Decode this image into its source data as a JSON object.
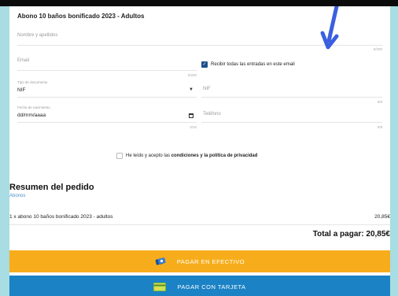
{
  "product": {
    "title": "Abono 10 baños bonificado 2023 - Adultos"
  },
  "form": {
    "name": {
      "placeholder": "Nombre y apellidos",
      "counter": "0/200"
    },
    "email": {
      "placeholder": "Email",
      "counter": "0/200"
    },
    "receive_checkbox": {
      "label": "Recibir todas las entradas en este email",
      "checked": true
    },
    "doc_type": {
      "label": "Tipo de documento",
      "value": "NIF"
    },
    "nif": {
      "placeholder": "NIF",
      "counter": "0/9"
    },
    "birth": {
      "label": "Fecha de nacimiento",
      "value": "dd/mm/aaaa",
      "counter": "0/10"
    },
    "phone": {
      "placeholder": "Teléfono",
      "counter": "0/9"
    },
    "terms": {
      "prefix": "He leído y acepto las ",
      "link": "condiciones y la política de privacidad",
      "checked": false
    }
  },
  "summary": {
    "title": "Resumen del pedido",
    "subtitle": "Abonos",
    "line_item": "1 x abono 10 baños bonificado 2023 - adultos",
    "line_price": "20,85€",
    "total": "Total a pagar: 20,85€"
  },
  "buttons": {
    "cash": {
      "label": "PAGAR EN EFECTIVO",
      "color": "#f7ad1b",
      "icon": "cash-icon"
    },
    "card": {
      "label": "PAGAR CON TARJETA",
      "color": "#1b82c5",
      "icon": "credit-card-icon"
    }
  },
  "colors": {
    "background": "#a8dde3",
    "accent": "#1b4f8a",
    "link": "#4a90c8",
    "annotation_arrow": "#3b5fe0"
  }
}
